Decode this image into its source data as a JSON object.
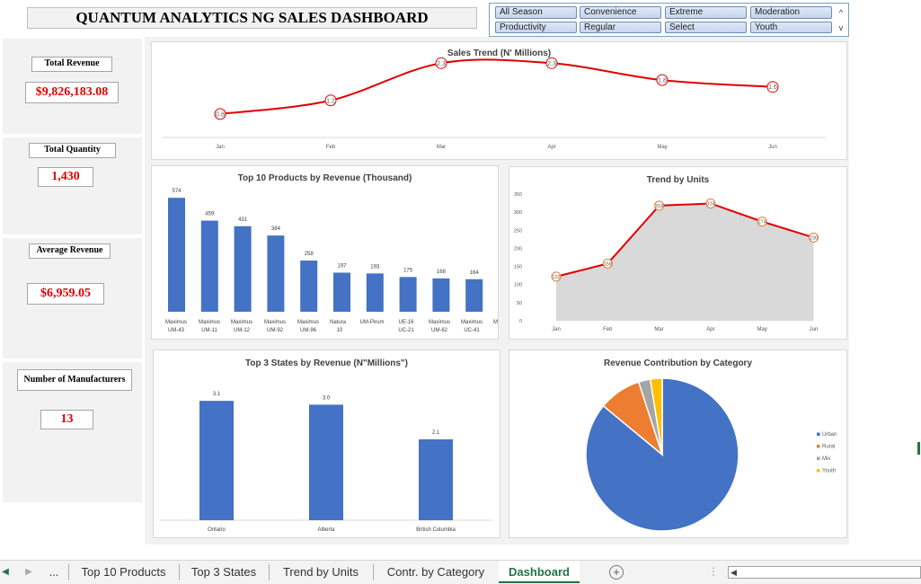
{
  "dashboard": {
    "title": "QUANTUM ANALYTICS NG SALES DASHBOARD"
  },
  "slicer": {
    "items": [
      "All Season",
      "Convenience",
      "Extreme",
      "Moderation",
      "Productivity",
      "Regular",
      "Select",
      "Youth"
    ],
    "scroll_up": "^",
    "scroll_down": "v"
  },
  "kpis": [
    {
      "label": "Total Revenue",
      "value": "$9,826,183.08"
    },
    {
      "label": "Total Quantity",
      "value": "1,430"
    },
    {
      "label": "Average Revenue",
      "value": "$6,959.05"
    },
    {
      "label": "Number of Manufacturers",
      "value": "13"
    }
  ],
  "colors": {
    "accent_red": "#e00000",
    "bar_blue": "#4472c4",
    "line_red": "#e00000",
    "excel_green": "#217346"
  },
  "chart_data": [
    {
      "type": "line",
      "title": "Sales Trend (N' Millions)",
      "categories": [
        "Jan",
        "Feb",
        "Mar",
        "Apr",
        "May",
        "Jun"
      ],
      "values": [
        0.8,
        1.2,
        2.3,
        2.3,
        1.8,
        1.6
      ],
      "data_labels": [
        "0.8",
        "1.2",
        "2.3",
        "2.3",
        "1.8",
        "1.6"
      ],
      "ylim": [
        0,
        2.6
      ],
      "smooth": true,
      "grid": false
    },
    {
      "type": "bar",
      "title": "Top 10 Products by Revenue (Thousand)",
      "categories": [
        [
          "Maximus",
          "UM-43"
        ],
        [
          "Maximus",
          "UM-11"
        ],
        [
          "Maximus",
          "UM-12"
        ],
        [
          "Maximus",
          "UM-92"
        ],
        [
          "Maximus",
          "UM-96"
        ],
        [
          "Natura",
          "10"
        ],
        [
          "UM-Pirum",
          ""
        ],
        [
          "UE-16",
          ""
        ],
        [
          "Maximus",
          "UC-21"
        ],
        [
          "Maximus",
          "UM-62"
        ],
        [
          "Maximus",
          "UC-41"
        ]
      ],
      "category_labels": [
        "Maximus UM-43",
        "Maximus UM-11",
        "Maximus UM-12",
        "Maximus UM-92",
        "Maximus UM-96",
        "Natura UM-Pirum UE-16 10",
        "Maximus UC-21",
        "Maximus UM-62",
        "Maximus UC-41"
      ],
      "values": [
        574,
        459,
        431,
        384,
        258,
        197,
        193,
        175,
        168,
        164
      ],
      "data_labels": [
        "574",
        "459",
        "431",
        "384",
        "258",
        "197",
        "193",
        "175",
        "168",
        "164"
      ],
      "ylim": [
        0,
        620
      ]
    },
    {
      "type": "area",
      "title": "Trend by Units",
      "categories": [
        "Jan",
        "Feb",
        "Mar",
        "Apr",
        "May",
        "Jun"
      ],
      "values": [
        122,
        158,
        318,
        324,
        274,
        230
      ],
      "data_labels": [
        "122",
        "158",
        "318",
        "324",
        "274",
        "230"
      ],
      "y_ticks": [
        "0",
        "50",
        "100",
        "150",
        "200",
        "250",
        "300",
        "350"
      ],
      "ylim": [
        0,
        350
      ]
    },
    {
      "type": "bar",
      "title": "Top 3 States by Revenue (N\"Millions\")",
      "categories": [
        "Ontario",
        "Alberta",
        "British Columbia"
      ],
      "values": [
        3.1,
        3.0,
        2.1
      ],
      "data_labels": [
        "3.1",
        "3.0",
        "2.1"
      ],
      "ylim": [
        0,
        3.5
      ]
    },
    {
      "type": "pie",
      "title": "Revenue Contribution by Category",
      "categories": [
        "Urban",
        "Rural",
        "Mix",
        "Youth"
      ],
      "values": [
        86,
        9,
        2.5,
        2.5
      ],
      "colors": [
        "#4472c4",
        "#ed7d31",
        "#a5a5a5",
        "#ffc000"
      ],
      "legend": "right"
    }
  ],
  "chart_texts": {
    "product_labels_line1": [
      "Maximus",
      "Maximus",
      "Maximus",
      "Maximus",
      "Maximus",
      "Natura",
      "UM-Pirum",
      "UE-16",
      "Maximus",
      "Maximus",
      "Maximus"
    ],
    "product_labels_line2": [
      "UM-43",
      "UM-11",
      "UM-12",
      "UM-92",
      "UM-96",
      "10",
      "UC-21",
      "UM-62",
      "UC-41"
    ]
  },
  "sheet_tabs": {
    "more": "...",
    "tabs": [
      "Top 10 Products",
      "Top 3 States",
      "Trend by Units",
      "Contr. by Category",
      "Dashboard"
    ],
    "add": "+"
  }
}
